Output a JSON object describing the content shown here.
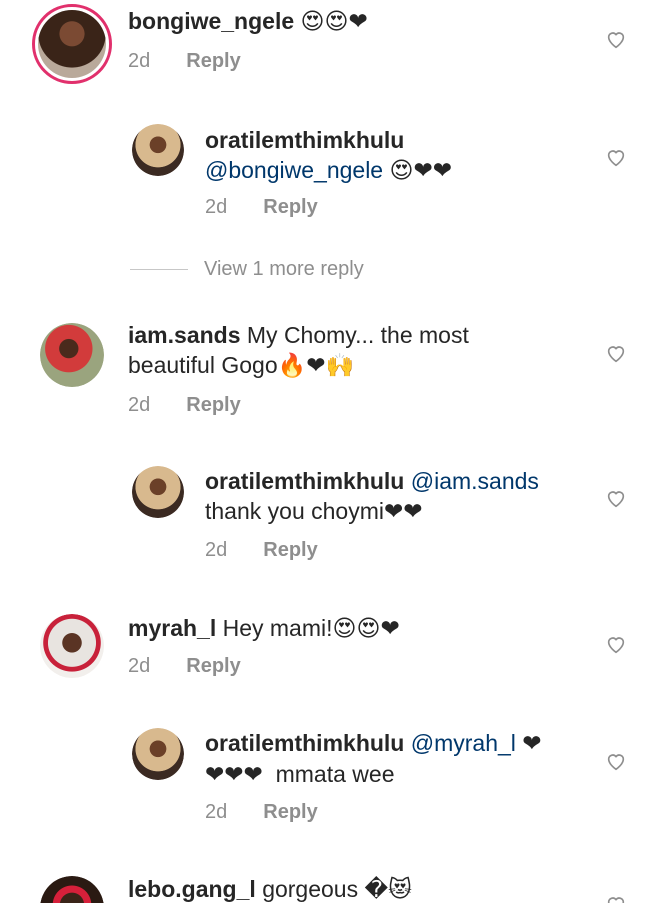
{
  "colors": {
    "username": "#262626",
    "mention": "#00376b",
    "muted": "#8e8e8e",
    "heart": "#ed1c24"
  },
  "comments": [
    {
      "username": "bongiwe_ngele",
      "text": "",
      "emojis": "😍😍❤",
      "time": "2d",
      "reply": "Reply"
    },
    {
      "username": "oratilemthimkhulu",
      "mention": "@bongiwe_ngele",
      "emojis": "😍❤❤",
      "time": "2d",
      "reply": "Reply"
    },
    {
      "username": "iam.sands",
      "text_line1": "My Chomy... the most",
      "text_line2": "beautiful Gogo",
      "emojis": "🔥❤🙌",
      "time": "2d",
      "reply": "Reply"
    },
    {
      "username": "oratilemthimkhulu",
      "mention": "@iam.sands",
      "text": "thank you choymi",
      "emojis": "❤❤",
      "time": "2d",
      "reply": "Reply"
    },
    {
      "username": "myrah_l",
      "text": "Hey mami!",
      "emojis": "😍😍❤",
      "time": "2d",
      "reply": "Reply"
    },
    {
      "username": "oratilemthimkhulu",
      "mention": "@myrah_l",
      "emojis_line1": "❤",
      "emojis_line2": "❤❤❤",
      "text": "mmata wee",
      "time": "2d",
      "reply": "Reply"
    },
    {
      "username": "lebo.gang_l",
      "text": "gorgeous",
      "emojis": "�😻"
    }
  ],
  "view_more": "View 1 more reply",
  "icons": {
    "like": "heart-outline-icon"
  }
}
